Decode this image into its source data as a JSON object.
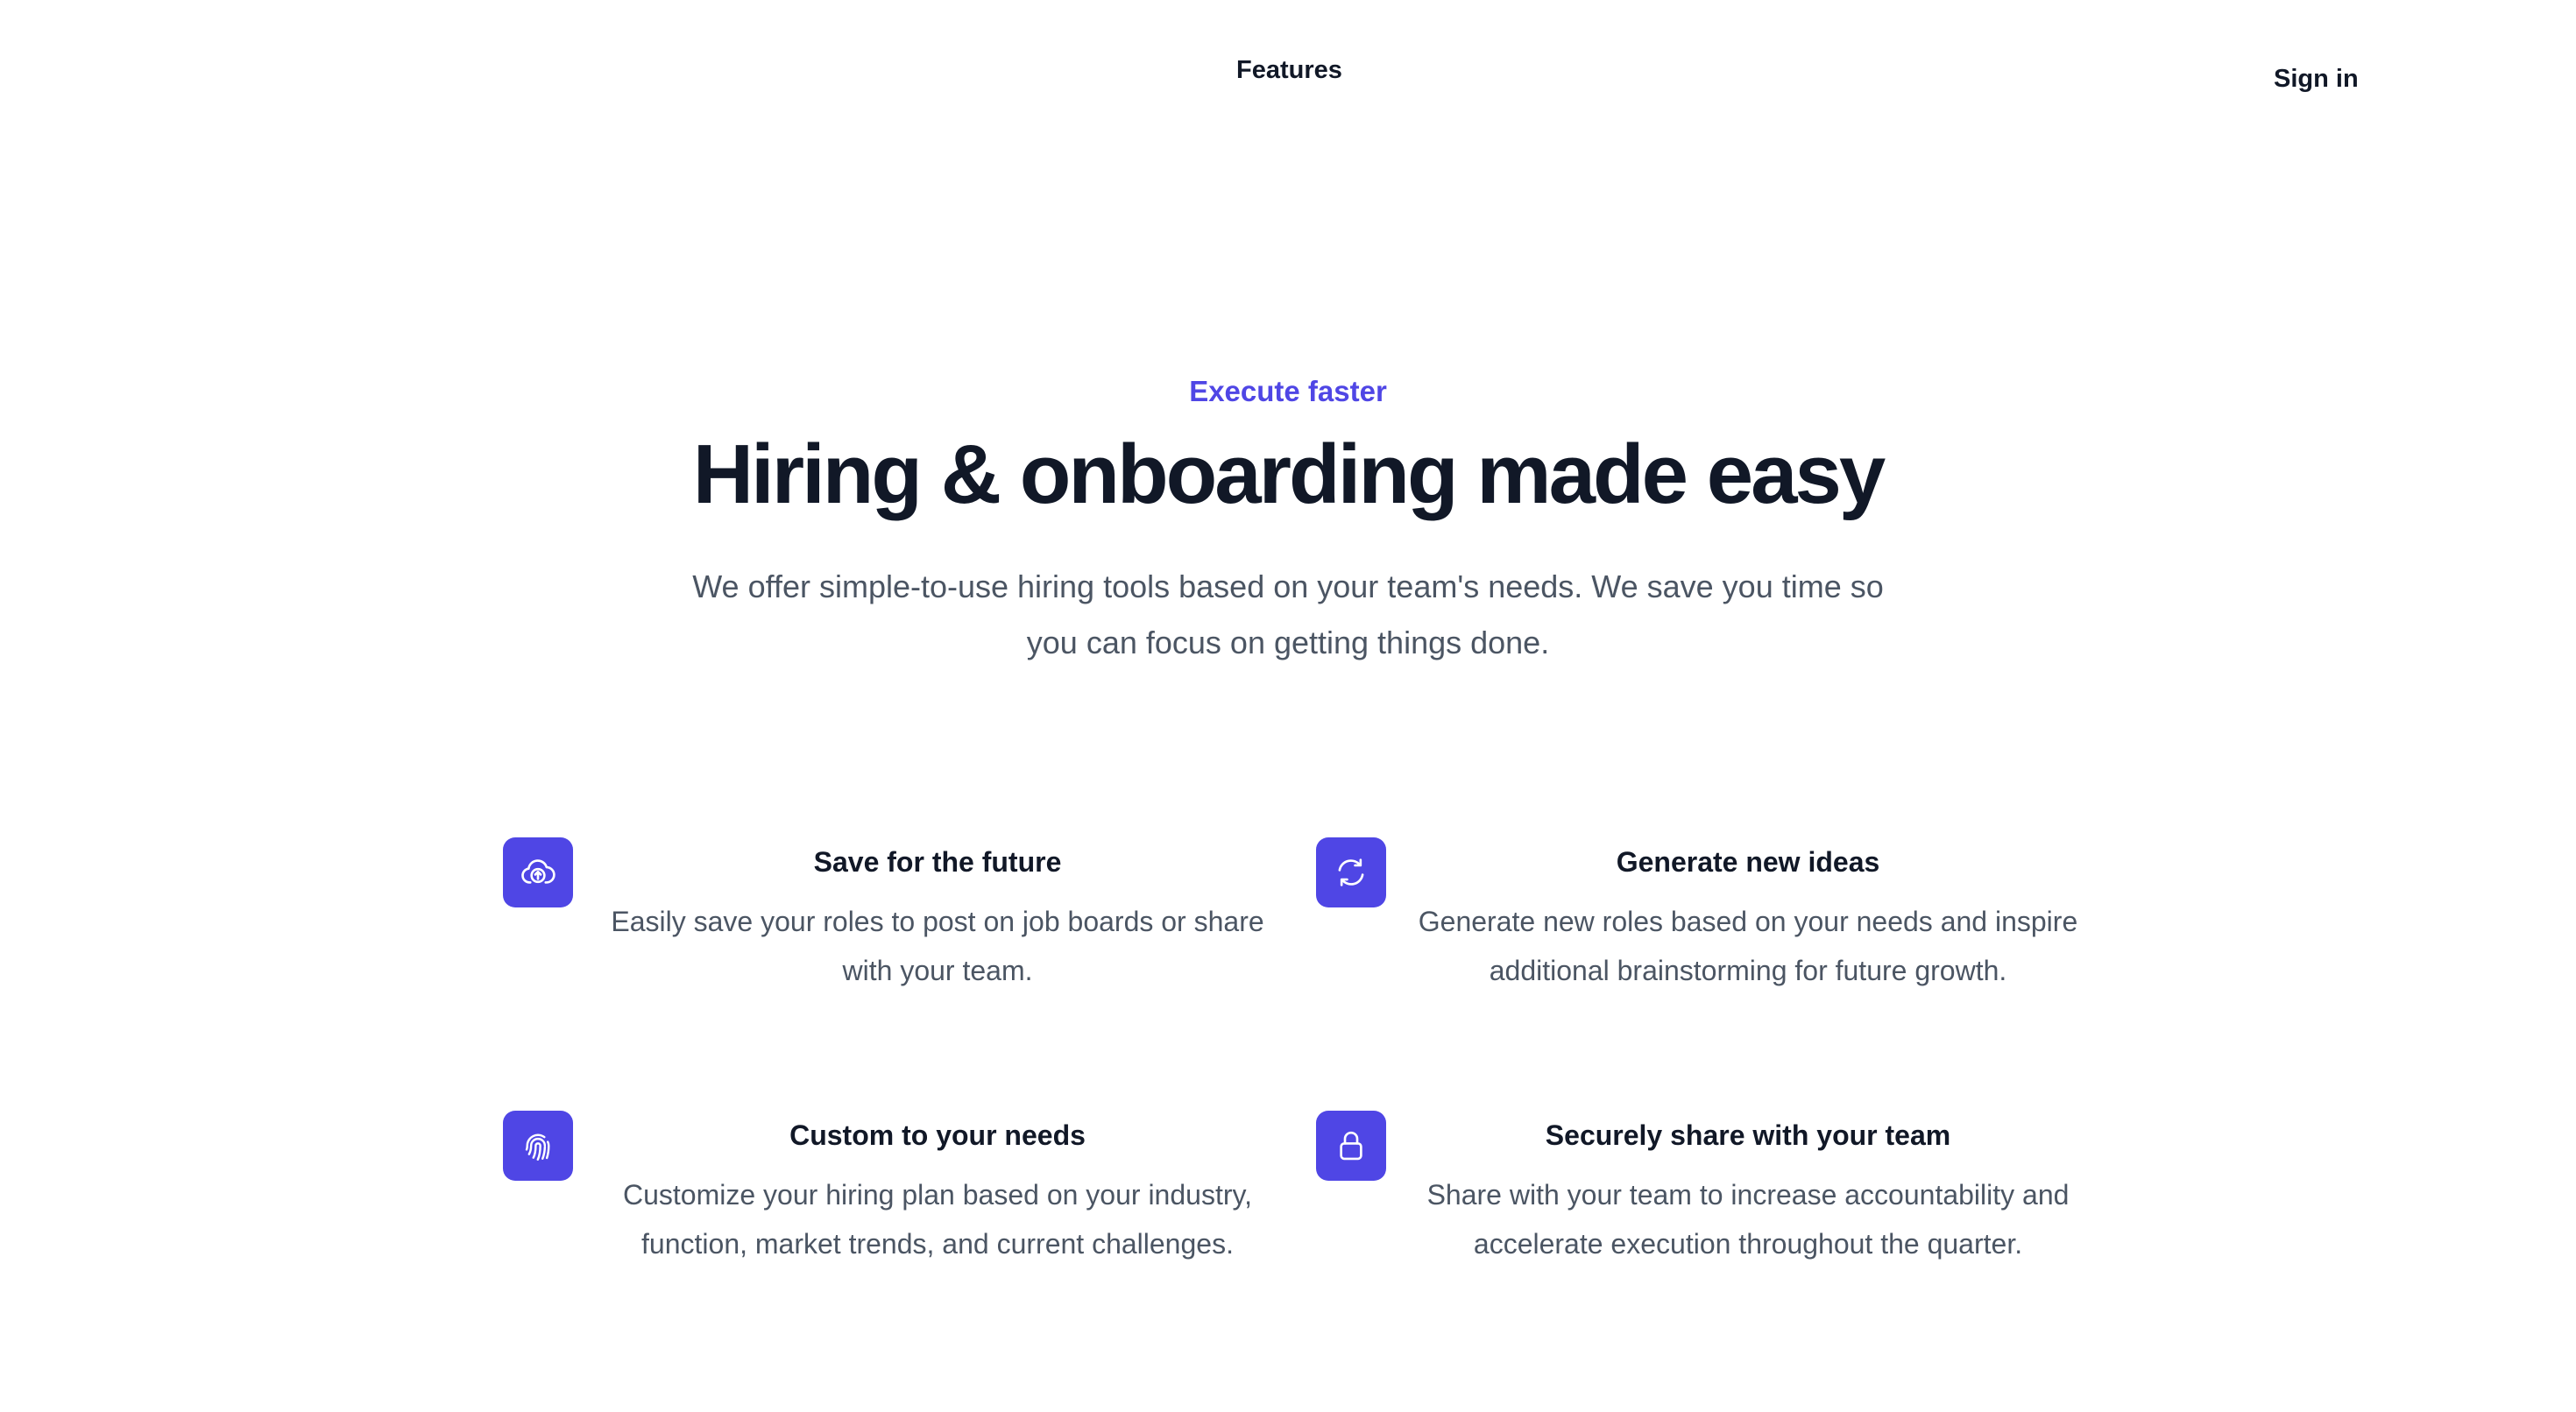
{
  "nav": {
    "features_label": "Features",
    "signin_label": "Sign in"
  },
  "hero": {
    "eyebrow": "Execute faster",
    "title": "Hiring & onboarding made easy",
    "lead": "We offer simple-to-use hiring tools based on your team's needs. We save you time so you can focus on getting things done."
  },
  "features": [
    {
      "icon": "cloud-upload-icon",
      "title": "Save for the future",
      "description": "Easily save your roles to post on job boards or share with your team."
    },
    {
      "icon": "refresh-icon",
      "title": "Generate new ideas",
      "description": "Generate new roles based on your needs and inspire additional brainstorming for future growth."
    },
    {
      "icon": "fingerprint-icon",
      "title": "Custom to your needs",
      "description": "Customize your hiring plan based on your industry, function, market trends, and current challenges."
    },
    {
      "icon": "lock-icon",
      "title": "Securely share with your team",
      "description": "Share with your team to increase accountability and accelerate execution throughout the quarter."
    }
  ],
  "colors": {
    "accent": "#4f46e5",
    "heading": "#111827",
    "body_text": "#4b5563",
    "background": "#ffffff"
  }
}
